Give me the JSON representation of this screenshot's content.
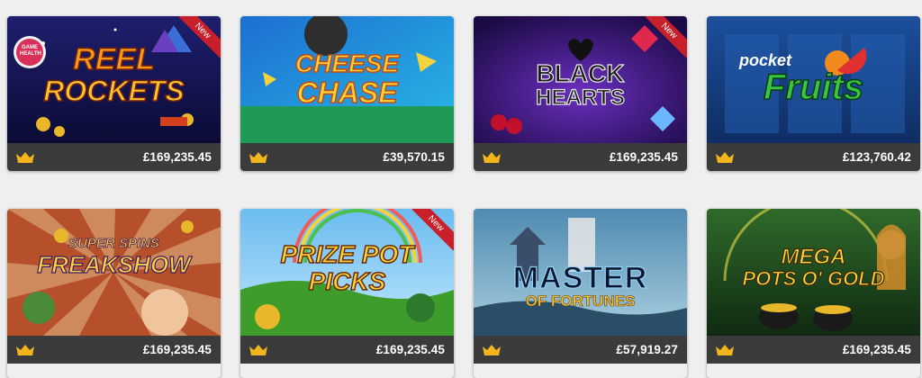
{
  "games": [
    {
      "title_lines": [
        "REEL",
        "ROCKETS"
      ],
      "jackpot": "£169,235.45",
      "badge": "New",
      "provider_badge": "GAME HEALTH"
    },
    {
      "title_lines": [
        "CHEESE",
        "CHASE"
      ],
      "jackpot": "£39,570.15",
      "badge": null
    },
    {
      "title_lines": [
        "BLACK",
        "HEARTS"
      ],
      "jackpot": "£169,235.45",
      "badge": "New"
    },
    {
      "title_lines": [
        "pocket",
        "Fruits"
      ],
      "jackpot": "£123,760.42",
      "badge": null
    },
    {
      "title_lines": [
        "SUPER SPINS",
        "FREAKSHOW"
      ],
      "jackpot": "£169,235.45",
      "badge": null
    },
    {
      "title_lines": [
        "PRIZE POT",
        "PICKS"
      ],
      "jackpot": "£169,235.45",
      "badge": "New"
    },
    {
      "title_lines": [
        "MASTER",
        "OF FORTUNES"
      ],
      "jackpot": "£57,919.27",
      "badge": null
    },
    {
      "title_lines": [
        "MEGA",
        "POTS O' GOLD"
      ],
      "jackpot": "£169,235.45",
      "badge": null
    }
  ],
  "colors": {
    "bar": "#3b3b3b",
    "crown": "#f2b61c",
    "ribbon": "#c8202a",
    "page_bg": "#efefef"
  },
  "icons": {
    "jackpot": "crown-icon"
  }
}
